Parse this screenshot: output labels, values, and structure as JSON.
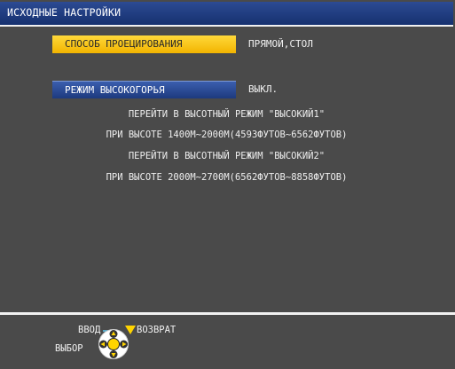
{
  "window": {
    "title": "ИСХОДНЫЕ НАСТРОЙКИ"
  },
  "menu": {
    "projection_method": {
      "label": "СПОСОБ ПРОЕЦИРОВАНИЯ",
      "value": "ПРЯМОЙ,СТОЛ"
    },
    "high_altitude_mode": {
      "label": "РЕЖИМ ВЫСОКОГОРЬЯ",
      "value": "ВЫКЛ."
    }
  },
  "info": {
    "line1": "ПЕРЕЙТИ В ВЫСОТНЫЙ РЕЖИМ \"ВЫСОКИЙ1\"",
    "line2": "ПРИ ВЫСОТЕ 1400М~2000М(4593ФУТОВ~6562ФУТОВ)",
    "line3": "ПЕРЕЙТИ В ВЫСОТНЫЙ РЕЖИМ \"ВЫСОКИЙ2\"",
    "line4": "ПРИ ВЫСОТЕ 2000М~2700М(6562ФУТОВ~8858ФУТОВ)"
  },
  "footer": {
    "enter_label": "ВВОД",
    "select_label": "ВЫБОР",
    "return_label": "ВОЗВРАТ",
    "icons": [
      "enter-button-icon",
      "dpad-icon",
      "return-button-icon"
    ]
  },
  "colors": {
    "background": "#4a4a4a",
    "title_bar": "#1f3a80",
    "selected_item": "#f7c51a",
    "blue_item": "#2a4b97",
    "text": "#f0f0f0"
  }
}
